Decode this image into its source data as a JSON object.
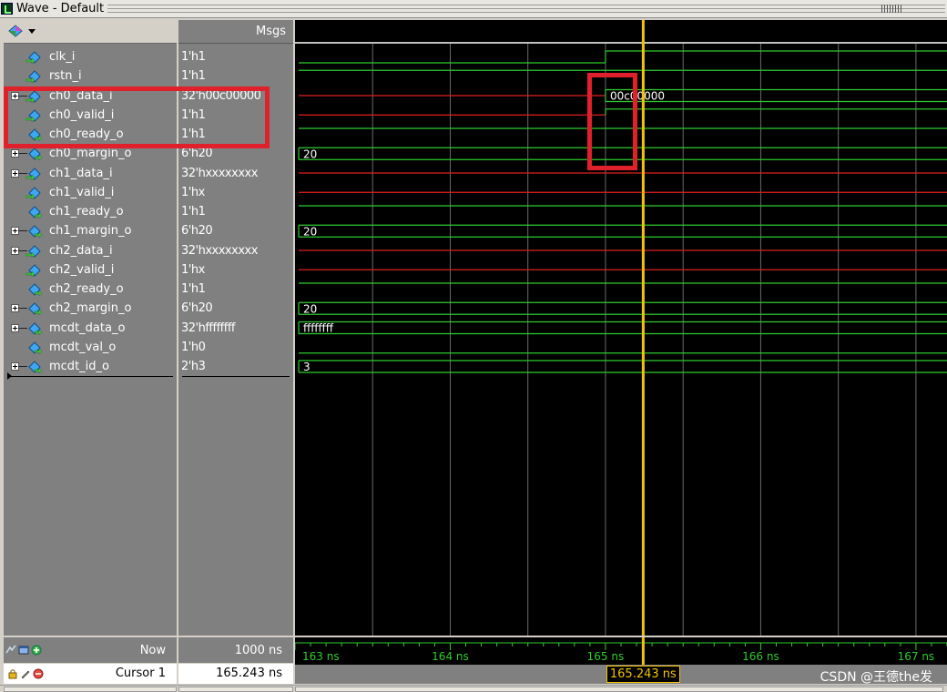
{
  "window": {
    "title": "Wave - Default"
  },
  "headers": {
    "msgs": "Msgs"
  },
  "signals": [
    {
      "name": "clk_i",
      "value": "1'h1",
      "expandable": false,
      "icon": "input-signal-icon"
    },
    {
      "name": "rstn_i",
      "value": "1'h1",
      "expandable": false,
      "icon": "input-signal-icon"
    },
    {
      "name": "ch0_data_i",
      "value": "32'h00c00000",
      "expandable": true,
      "icon": "input-signal-icon"
    },
    {
      "name": "ch0_valid_i",
      "value": "1'h1",
      "expandable": false,
      "icon": "input-signal-icon"
    },
    {
      "name": "ch0_ready_o",
      "value": "1'h1",
      "expandable": false,
      "icon": "output-signal-icon"
    },
    {
      "name": "ch0_margin_o",
      "value": "6'h20",
      "expandable": true,
      "icon": "output-signal-icon"
    },
    {
      "name": "ch1_data_i",
      "value": "32'hxxxxxxxx",
      "expandable": true,
      "icon": "input-signal-icon"
    },
    {
      "name": "ch1_valid_i",
      "value": "1'hx",
      "expandable": false,
      "icon": "input-signal-icon"
    },
    {
      "name": "ch1_ready_o",
      "value": "1'h1",
      "expandable": false,
      "icon": "output-signal-icon"
    },
    {
      "name": "ch1_margin_o",
      "value": "6'h20",
      "expandable": true,
      "icon": "output-signal-icon"
    },
    {
      "name": "ch2_data_i",
      "value": "32'hxxxxxxxx",
      "expandable": true,
      "icon": "input-signal-icon"
    },
    {
      "name": "ch2_valid_i",
      "value": "1'hx",
      "expandable": false,
      "icon": "input-signal-icon"
    },
    {
      "name": "ch2_ready_o",
      "value": "1'h1",
      "expandable": false,
      "icon": "output-signal-icon"
    },
    {
      "name": "ch2_margin_o",
      "value": "6'h20",
      "expandable": true,
      "icon": "output-signal-icon"
    },
    {
      "name": "mcdt_data_o",
      "value": "32'hffffffff",
      "expandable": true,
      "icon": "output-signal-icon"
    },
    {
      "name": "mcdt_val_o",
      "value": "1'h0",
      "expandable": false,
      "icon": "output-signal-icon"
    },
    {
      "name": "mcdt_id_o",
      "value": "2'h3",
      "expandable": true,
      "icon": "output-signal-icon"
    }
  ],
  "waves": [
    {
      "kind": "bit",
      "segments": [
        {
          "t0": 163.0,
          "t1": 165.0,
          "level": "low"
        },
        {
          "t0": 165.0,
          "t1": 167.2,
          "level": "high"
        }
      ]
    },
    {
      "kind": "bit",
      "segments": [
        {
          "t0": 163.0,
          "t1": 167.2,
          "level": "high"
        }
      ]
    },
    {
      "kind": "bus",
      "segments": [
        {
          "t0": 163.0,
          "t1": 165.0,
          "state": "x"
        },
        {
          "t0": 165.0,
          "t1": 167.2,
          "state": "valid",
          "text": "00c00000"
        }
      ]
    },
    {
      "kind": "bit",
      "segments": [
        {
          "t0": 163.0,
          "t1": 165.0,
          "level": "x"
        },
        {
          "t0": 165.0,
          "t1": 167.2,
          "level": "high"
        }
      ]
    },
    {
      "kind": "bit",
      "segments": [
        {
          "t0": 163.0,
          "t1": 167.2,
          "level": "high"
        }
      ]
    },
    {
      "kind": "bus",
      "segments": [
        {
          "t0": 163.0,
          "t1": 167.2,
          "state": "valid",
          "text": "20"
        }
      ]
    },
    {
      "kind": "bus",
      "segments": [
        {
          "t0": 163.0,
          "t1": 167.2,
          "state": "x"
        }
      ]
    },
    {
      "kind": "bit",
      "segments": [
        {
          "t0": 163.0,
          "t1": 167.2,
          "level": "x"
        }
      ]
    },
    {
      "kind": "bit",
      "segments": [
        {
          "t0": 163.0,
          "t1": 167.2,
          "level": "high"
        }
      ]
    },
    {
      "kind": "bus",
      "segments": [
        {
          "t0": 163.0,
          "t1": 167.2,
          "state": "valid",
          "text": "20"
        }
      ]
    },
    {
      "kind": "bus",
      "segments": [
        {
          "t0": 163.0,
          "t1": 167.2,
          "state": "x"
        }
      ]
    },
    {
      "kind": "bit",
      "segments": [
        {
          "t0": 163.0,
          "t1": 167.2,
          "level": "x"
        }
      ]
    },
    {
      "kind": "bit",
      "segments": [
        {
          "t0": 163.0,
          "t1": 167.2,
          "level": "high"
        }
      ]
    },
    {
      "kind": "bus",
      "segments": [
        {
          "t0": 163.0,
          "t1": 167.2,
          "state": "valid",
          "text": "20"
        }
      ]
    },
    {
      "kind": "bus",
      "segments": [
        {
          "t0": 163.0,
          "t1": 167.2,
          "state": "valid",
          "text": "ffffffff"
        }
      ]
    },
    {
      "kind": "bit",
      "segments": [
        {
          "t0": 163.0,
          "t1": 167.2,
          "level": "low"
        }
      ]
    },
    {
      "kind": "bus",
      "segments": [
        {
          "t0": 163.0,
          "t1": 167.2,
          "state": "valid",
          "text": "3"
        }
      ]
    }
  ],
  "timeline": {
    "start_ns": 163.0,
    "end_ns": 167.2,
    "major_ticks": [
      {
        "t": 163,
        "label": "163 ns"
      },
      {
        "t": 164,
        "label": "164 ns"
      },
      {
        "t": 165,
        "label": "165 ns"
      },
      {
        "t": 166,
        "label": "166 ns"
      },
      {
        "t": 167,
        "label": "167 ns"
      }
    ],
    "grid_step_ns": 0.5
  },
  "status": {
    "now_label": "Now",
    "now_value": "1000 ns",
    "cursor_label": "Cursor 1",
    "cursor_value": "165.243 ns",
    "cursor_time_ns": 165.243,
    "cursor_box_text": "165.243 ns"
  },
  "watermark": "CSDN @王德the发",
  "colors": {
    "wave_green": "#2ecc2e",
    "wave_red": "#e02020",
    "cursor": "#f4c400",
    "grid": "#6a6a6a",
    "highlight": "#e0202a"
  }
}
